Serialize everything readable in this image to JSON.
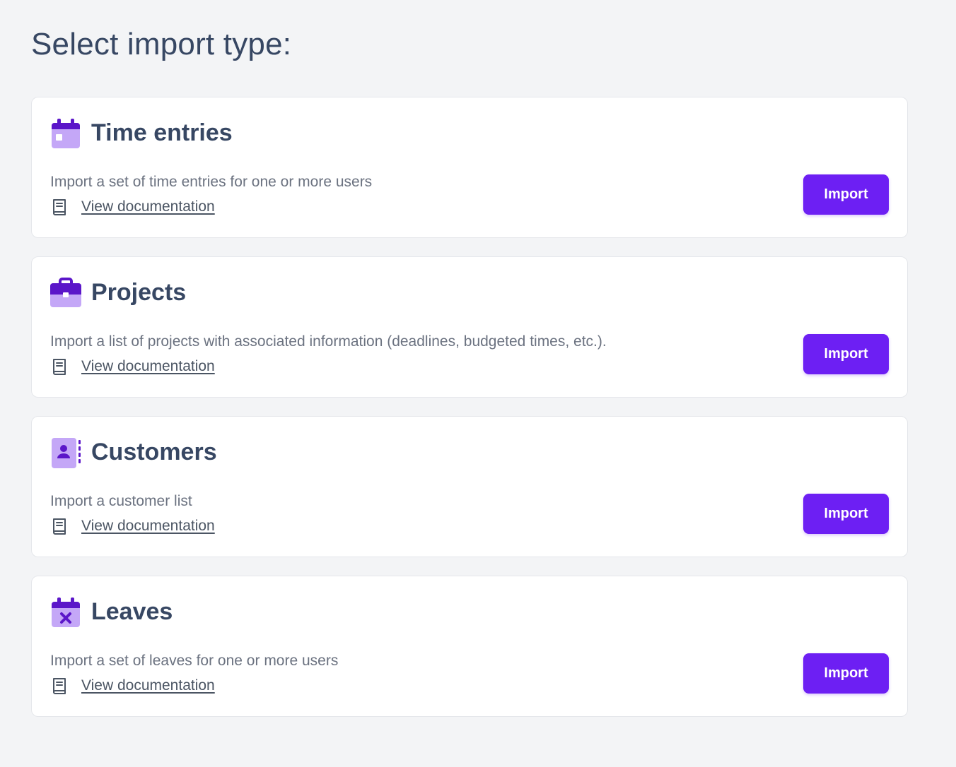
{
  "page": {
    "title": "Select import type:"
  },
  "theme": {
    "accent": "#6d1ff3",
    "icon_dark": "#5b16c9",
    "icon_light": "#c4a7f7",
    "title_color": "#374763",
    "muted_text": "#6b7280"
  },
  "import_types": [
    {
      "title": "Time entries",
      "description": "Import a set of time entries for one or more users",
      "doc_label": "View documentation",
      "button_label": "Import",
      "icon": "calendar-icon"
    },
    {
      "title": "Projects",
      "description": "Import a list of projects with associated information (deadlines, budgeted times, etc.).",
      "doc_label": "View documentation",
      "button_label": "Import",
      "icon": "briefcase-icon"
    },
    {
      "title": "Customers",
      "description": "Import a customer list",
      "doc_label": "View documentation",
      "button_label": "Import",
      "icon": "contact-book-icon"
    },
    {
      "title": "Leaves",
      "description": "Import a set of leaves for one or more users",
      "doc_label": "View documentation",
      "button_label": "Import",
      "icon": "calendar-x-icon"
    }
  ]
}
